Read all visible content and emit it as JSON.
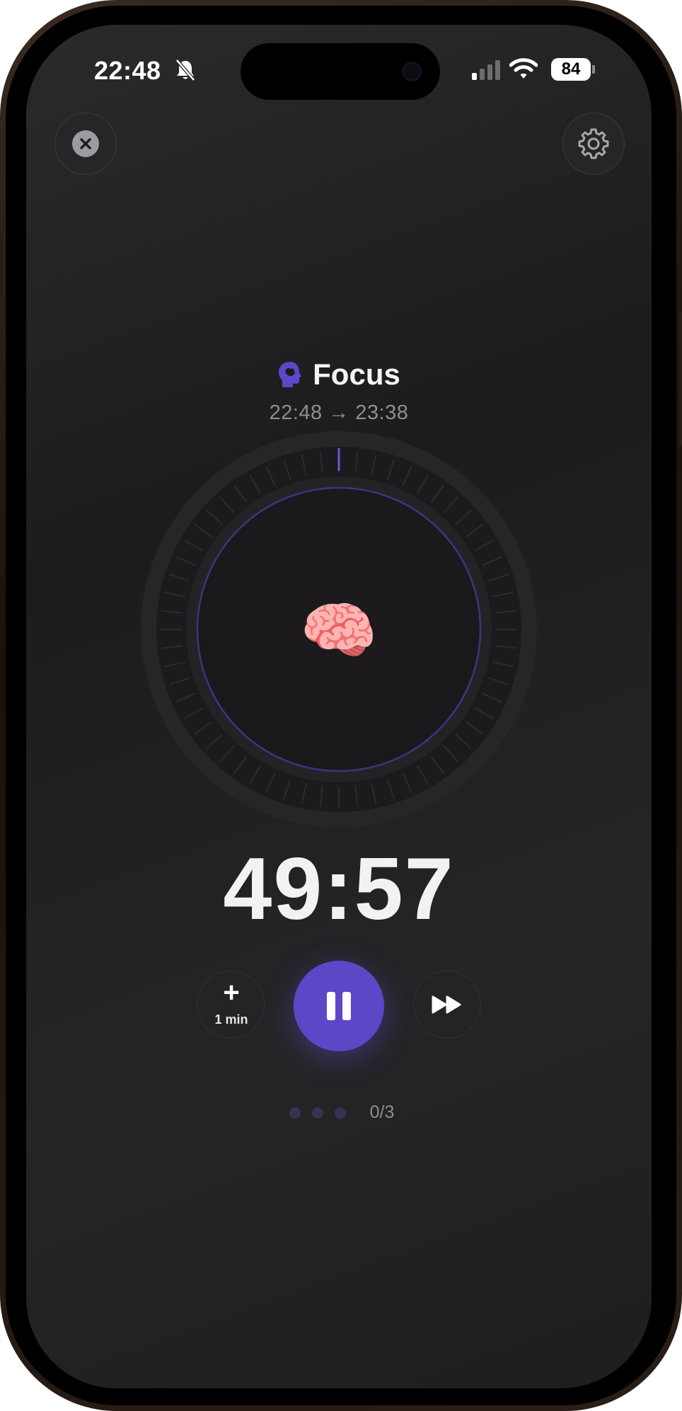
{
  "status_bar": {
    "time": "22:48",
    "battery_level": "84",
    "icons": [
      "bell-slash-icon",
      "cellular-signal-icon",
      "wifi-icon",
      "battery-icon"
    ]
  },
  "header": {
    "close_icon": "close-icon",
    "settings_icon": "gear-icon"
  },
  "session": {
    "title": "Focus",
    "time_range": "22:48 → 23:38",
    "emoji": "🧠",
    "accent_color": "#5d47c7"
  },
  "timer": {
    "remaining": "49:57",
    "elapsed_fraction": 0.001
  },
  "controls": {
    "add_time_symbol": "+",
    "add_time_label": "1 min",
    "pause_icon": "pause-icon",
    "skip_icon": "fast-forward-icon"
  },
  "progress": {
    "completed": 0,
    "total": 3,
    "label": "0/3"
  }
}
